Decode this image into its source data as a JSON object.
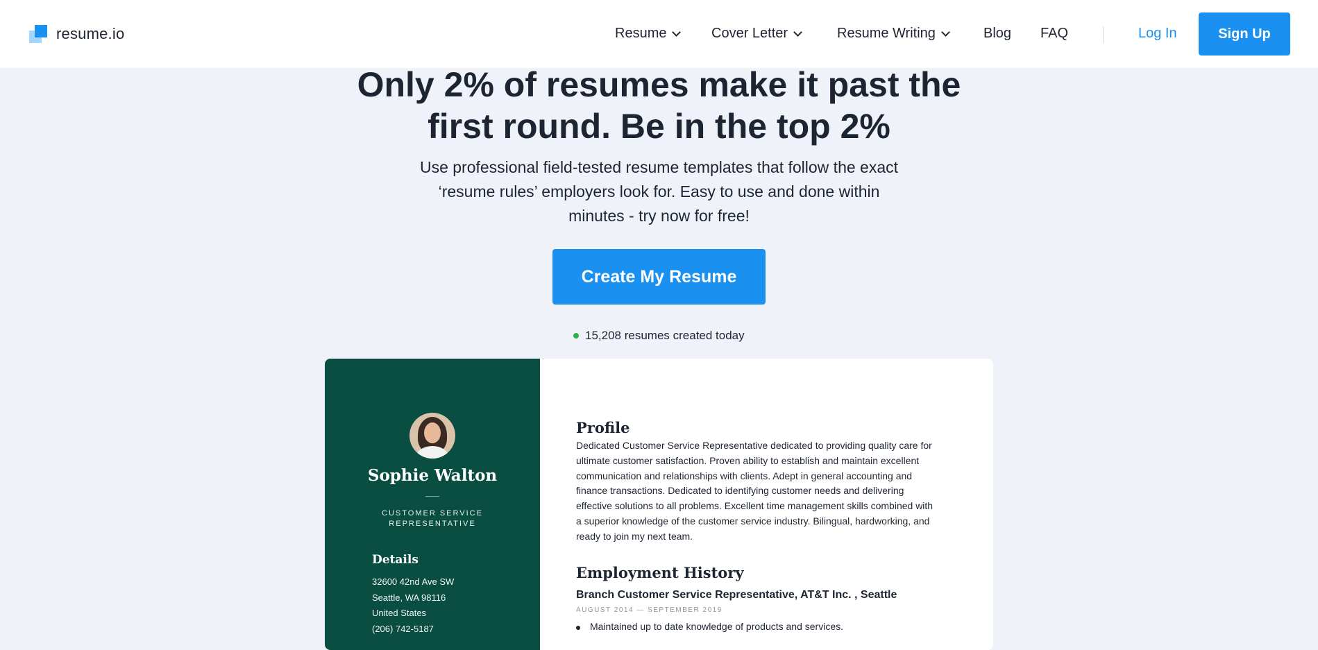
{
  "header": {
    "logo_text": "resume.io",
    "nav": [
      {
        "label": "Resume",
        "dropdown": true
      },
      {
        "label": "Cover Letter",
        "dropdown": true
      },
      {
        "label": "Resume Writing",
        "dropdown": true
      },
      {
        "label": "Blog",
        "dropdown": false
      },
      {
        "label": "FAQ",
        "dropdown": false
      }
    ],
    "login_label": "Log In",
    "signup_label": "Sign Up"
  },
  "hero": {
    "title_line1": "Only 2% of resumes make it past the",
    "title_line2": "first round. Be in the top 2%",
    "subtitle_line1": "Use professional field-tested resume templates that follow the exact",
    "subtitle_line2": "‘resume rules’ employers look for. Easy to use and done within",
    "subtitle_line3": "minutes - try now for free!",
    "cta_label": "Create My Resume",
    "counter_text": "15,208 resumes created today"
  },
  "resume": {
    "name": "Sophie Walton",
    "role_line1": "CUSTOMER SERVICE",
    "role_line2": "REPRESENTATIVE",
    "details_heading": "Details",
    "details": [
      "32600 42nd Ave SW",
      "Seattle, WA 98116",
      "United States",
      "(206) 742-5187"
    ],
    "profile_heading": "Profile",
    "profile_lines": [
      "Dedicated Customer Service Representative dedicated to providing quality care for",
      "ultimate customer satisfaction. Proven ability to establish and maintain excellent",
      "communication and relationships with clients. Adept in general accounting and",
      "finance transactions. Dedicated to identifying customer needs and delivering",
      "effective solutions to all problems. Excellent time management skills combined with",
      "a superior knowledge of the customer service industry. Bilingual, hardworking, and",
      "ready to join my next team."
    ],
    "employment_heading": "Employment History",
    "job_title": "Branch Customer Service Representative, AT&T Inc. , Seattle",
    "job_dates": "AUGUST 2014 — SEPTEMBER 2019",
    "job_bullet": "Maintained up to date knowledge of products and services."
  },
  "colors": {
    "accent": "#1a91f0",
    "page_bg": "#eff2f9",
    "resume_sidebar": "#0a4d41",
    "counter_dot": "#2db24a"
  }
}
